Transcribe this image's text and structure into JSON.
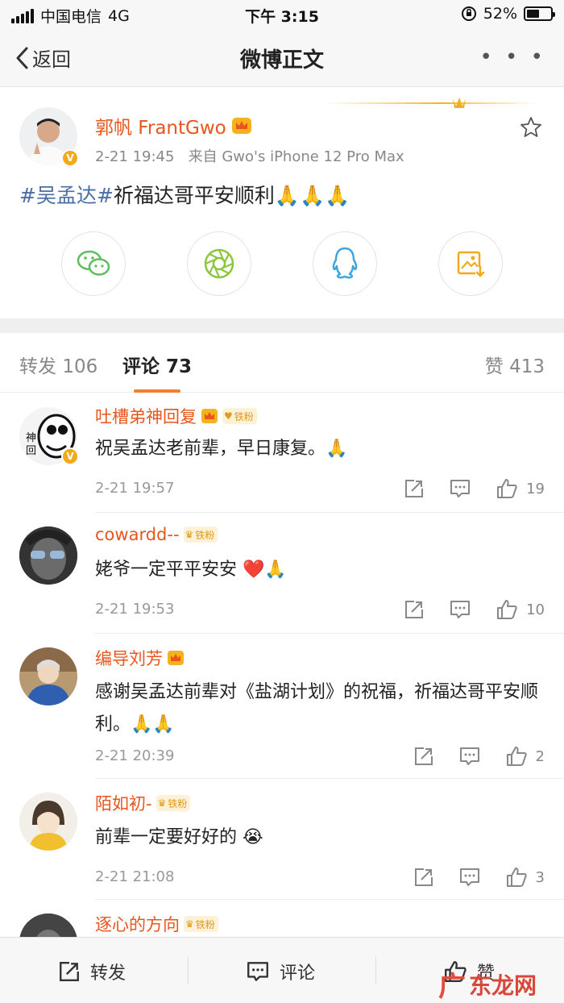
{
  "status_bar": {
    "carrier": "中国电信",
    "network": "4G",
    "time": "下午 3:15",
    "battery": "52%",
    "battery_level": 0.52
  },
  "nav": {
    "back_label": "返回",
    "title": "微博正文",
    "more": "• • •"
  },
  "post": {
    "author": "郭帆 FrantGwo",
    "time": "2-21 19:45",
    "source": "来自 Gwo's iPhone 12 Pro Max",
    "topic": "#吴孟达#",
    "text": "祈福达哥平安顺利",
    "emoji": "🙏🙏🙏"
  },
  "share_icons": [
    "wechat-icon",
    "moments-icon",
    "qq-icon",
    "save-image-icon"
  ],
  "tabs": {
    "repost_label": "转发",
    "repost_count": "106",
    "comment_label": "评论",
    "comment_count": "73",
    "like_label": "赞",
    "like_count": "413"
  },
  "fan_badge": "铁粉",
  "comments": [
    {
      "name": "吐槽弟神回复",
      "text": "祝吴孟达老前辈，早日康复。🙏",
      "time": "2-21 19:57",
      "likes": "19"
    },
    {
      "name": "cowardd--",
      "text": "姥爷一定平平安安 ❤️🙏",
      "time": "2-21 19:53",
      "likes": "10"
    },
    {
      "name": "编导刘芳",
      "text": "感谢吴孟达前辈对《盐湖计划》的祝福，祈福达哥平安顺利。🙏🙏",
      "time": "2-21 20:39",
      "likes": "2"
    },
    {
      "name": "陌如初-",
      "text": "前辈一定要好好的 😭",
      "time": "2-21 21:08",
      "likes": "3"
    },
    {
      "name": "逐心的方向"
    }
  ],
  "bottom_bar": {
    "repost": "转发",
    "comment": "评论",
    "like": "赞"
  },
  "watermark": {
    "glyph": "广",
    "text": "东龙网"
  },
  "colors": {
    "accent": "#f07f2f",
    "username": "#e8561d",
    "topic": "#4a6fa5"
  }
}
